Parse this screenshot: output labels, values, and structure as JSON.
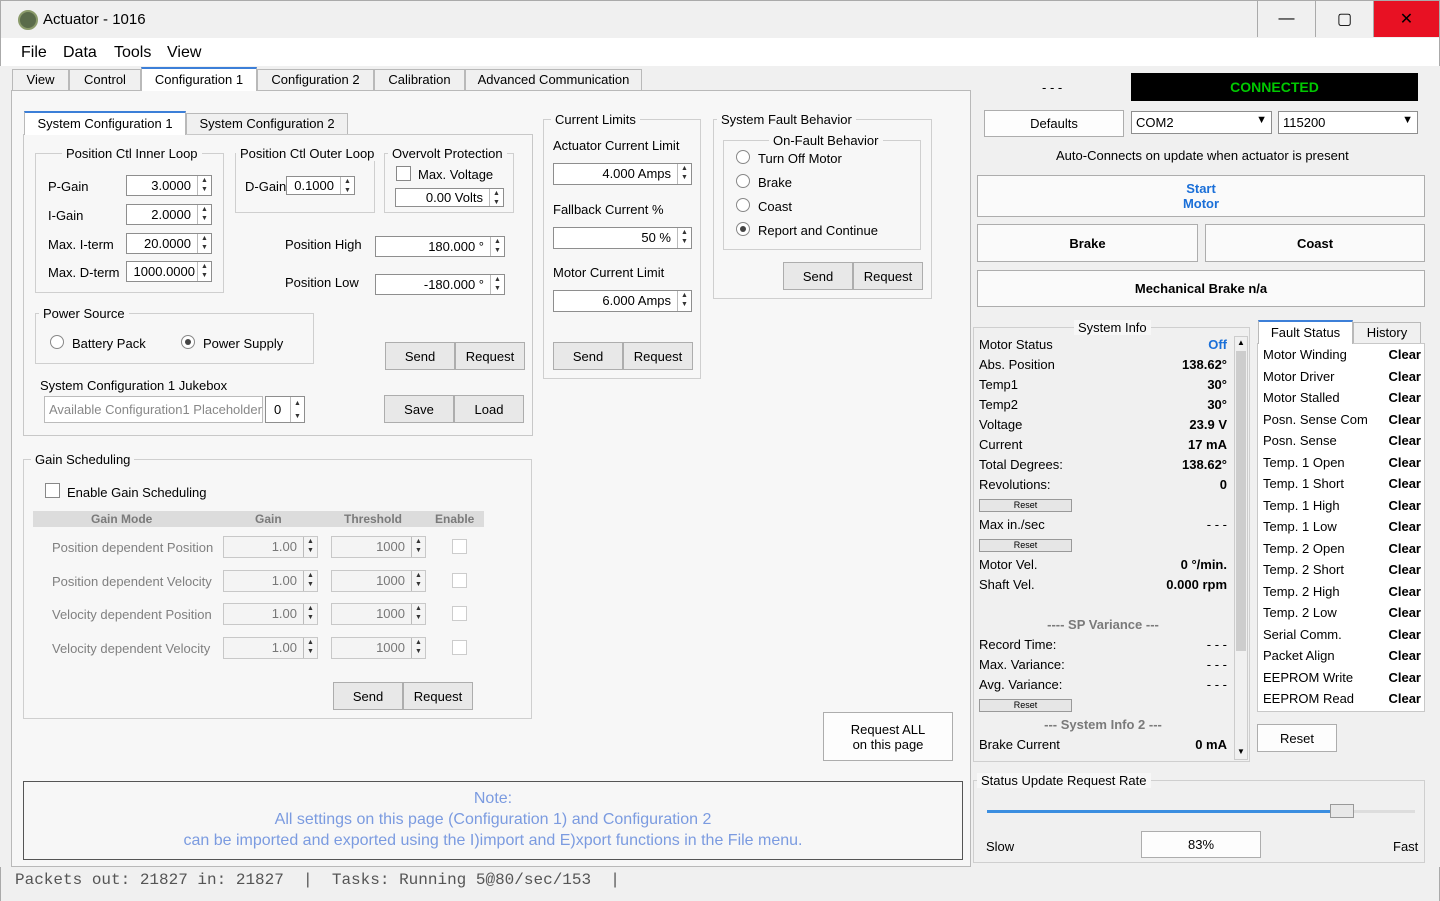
{
  "window": {
    "title": "Actuator - 1016",
    "minimize": "—",
    "maximize": "▢",
    "close": "✕"
  },
  "menu": [
    "File",
    "Data",
    "Tools",
    "View"
  ],
  "tabs": [
    "View",
    "Control",
    "Configuration 1",
    "Configuration 2",
    "Calibration",
    "Advanced Communication"
  ],
  "subtabs": [
    "System Configuration 1",
    "System Configuration 2"
  ],
  "inner_loop": {
    "title": "Position Ctl Inner Loop",
    "rows": [
      {
        "label": "P-Gain",
        "value": "3.0000"
      },
      {
        "label": "I-Gain",
        "value": "2.0000"
      },
      {
        "label": "Max. I-term",
        "value": "20.0000"
      },
      {
        "label": "Max. D-term",
        "value": "1000.0000"
      }
    ]
  },
  "outer_loop": {
    "title": "Position Ctl Outer Loop",
    "label": "D-Gain",
    "value": "0.1000"
  },
  "overvolt": {
    "title": "Overvolt Protection",
    "checkbox_label": "Max. Voltage",
    "value": "0.00 Volts"
  },
  "position": {
    "high_label": "Position High",
    "high_value": "180.000 °",
    "low_label": "Position Low",
    "low_value": "-180.000 °"
  },
  "power_source": {
    "title": "Power Source",
    "options": [
      "Battery Pack",
      "Power Supply"
    ],
    "selected": "Power Supply"
  },
  "jukebox": {
    "title": "System Configuration 1 Jukebox",
    "placeholder": "Available Configuration1 Placeholder",
    "index": "0",
    "save": "Save",
    "load": "Load"
  },
  "buttons": {
    "send": "Send",
    "request": "Request"
  },
  "current_limits": {
    "title": "Current Limits",
    "actuator_label": "Actuator Current Limit",
    "actuator_value": "4.000 Amps",
    "fallback_label": "Fallback Current %",
    "fallback_value": "50 %",
    "motor_label": "Motor Current Limit",
    "motor_value": "6.000 Amps"
  },
  "fault_behavior": {
    "title": "System Fault Behavior",
    "subtitle": "On-Fault Behavior",
    "options": [
      "Turn Off Motor",
      "Brake",
      "Coast",
      "Report and Continue"
    ],
    "selected": "Report and Continue"
  },
  "gain_scheduling": {
    "title": "Gain Scheduling",
    "enable_label": "Enable Gain Scheduling",
    "headers": [
      "Gain Mode",
      "Gain",
      "Threshold",
      "Enable"
    ],
    "rows": [
      {
        "mode": "Position dependent Position",
        "gain": "1.00",
        "threshold": "1000"
      },
      {
        "mode": "Position dependent Velocity",
        "gain": "1.00",
        "threshold": "1000"
      },
      {
        "mode": "Velocity dependent Position",
        "gain": "1.00",
        "threshold": "1000"
      },
      {
        "mode": "Velocity dependent Velocity",
        "gain": "1.00",
        "threshold": "1000"
      }
    ]
  },
  "request_all": {
    "line1": "Request ALL",
    "line2": "on this page"
  },
  "note": {
    "line1": "Note:",
    "line2": "All settings on this page (Configuration 1) and Configuration 2",
    "line3": "can be imported and exported using the I)import and E)xport functions in the File menu."
  },
  "status_bar": "Packets out: 21827 in: 21827  |  Tasks: Running 5@80/sec/153  |",
  "connection": {
    "dashes": "- - -",
    "status": "CONNECTED",
    "status_color": "#00c800",
    "defaults": "Defaults",
    "port": "COM2",
    "baud": "115200",
    "auto_text": "Auto-Connects on update when actuator is present"
  },
  "motor_buttons": {
    "start_line1": "Start",
    "start_line2": "Motor",
    "start_color": "#1a6fd8",
    "brake": "Brake",
    "coast": "Coast",
    "mech_brake": "Mechanical Brake n/a"
  },
  "system_info": {
    "title": "System Info",
    "rows": [
      {
        "label": "Motor Status",
        "value": "Off",
        "color": "#1a6fd8"
      },
      {
        "label": "Abs. Position",
        "value": "138.62°"
      },
      {
        "label": "Temp1",
        "value": "30°"
      },
      {
        "label": "Temp2",
        "value": "30°"
      },
      {
        "label": "Voltage",
        "value": "23.9 V"
      },
      {
        "label": "Current",
        "value": "17 mA"
      },
      {
        "label": "Total Degrees:",
        "value": "138.62°"
      },
      {
        "label": "Revolutions:",
        "value": "0"
      }
    ],
    "reset": "Reset",
    "max_in_sec_label": "Max in./sec",
    "max_in_sec_value": "- - -",
    "motor_vel_label": "Motor Vel.",
    "motor_vel_value": "0 °/min.",
    "shaft_vel_label": "Shaft Vel.",
    "shaft_vel_value": "0.000 rpm",
    "sp_variance_title": "---- SP Variance ---",
    "variance_rows": [
      {
        "label": "Record Time:",
        "value": "- - -"
      },
      {
        "label": "Max. Variance:",
        "value": "- - -"
      },
      {
        "label": "Avg. Variance:",
        "value": "- - -"
      }
    ],
    "info2_title": "--- System Info 2 ---",
    "brake_current_label": "Brake Current",
    "brake_current_value": "0 mA"
  },
  "fault_status": {
    "tabs": [
      "Fault Status",
      "History"
    ],
    "rows": [
      {
        "label": "Motor Winding",
        "value": "Clear"
      },
      {
        "label": "Motor Driver",
        "value": "Clear"
      },
      {
        "label": "Motor Stalled",
        "value": "Clear"
      },
      {
        "label": "Posn. Sense Com",
        "value": "Clear"
      },
      {
        "label": "Posn. Sense",
        "value": "Clear"
      },
      {
        "label": "Temp. 1 Open",
        "value": "Clear"
      },
      {
        "label": "Temp. 1 Short",
        "value": "Clear"
      },
      {
        "label": "Temp. 1 High",
        "value": "Clear"
      },
      {
        "label": "Temp. 1 Low",
        "value": "Clear"
      },
      {
        "label": "Temp. 2 Open",
        "value": "Clear"
      },
      {
        "label": "Temp. 2 Short",
        "value": "Clear"
      },
      {
        "label": "Temp. 2 High",
        "value": "Clear"
      },
      {
        "label": "Temp. 2 Low",
        "value": "Clear"
      },
      {
        "label": "Serial Comm.",
        "value": "Clear"
      },
      {
        "label": "Packet Align",
        "value": "Clear"
      },
      {
        "label": "EEPROM Write",
        "value": "Clear"
      },
      {
        "label": "EEPROM Read",
        "value": "Clear"
      }
    ],
    "reset": "Reset"
  },
  "update_rate": {
    "title": "Status Update Request Rate",
    "slow": "Slow",
    "fast": "Fast",
    "value": "83%",
    "fraction": 0.83
  }
}
